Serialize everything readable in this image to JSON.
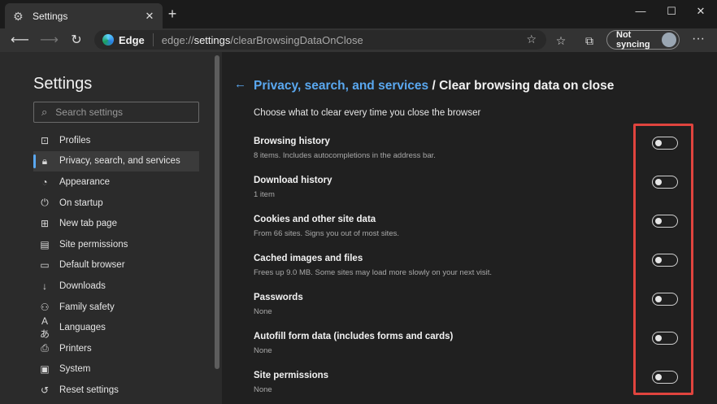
{
  "browser": {
    "tab_title": "Settings",
    "tab_close": "✕",
    "new_tab": "+",
    "window_controls": {
      "minimize": "—",
      "maximize": "☐",
      "close": "✕"
    },
    "edge_label": "Edge",
    "url_scheme": "edge://",
    "url_host": "settings",
    "url_path": "/clearBrowsingDataOnClose",
    "sync_label": "Not syncing",
    "more_label": "···"
  },
  "sidebar": {
    "title": "Settings",
    "search_placeholder": "Search settings",
    "items": [
      {
        "label": "Profiles",
        "icon": "profile-icon",
        "glyph": "⊡"
      },
      {
        "label": "Privacy, search, and services",
        "icon": "lock-icon",
        "glyph": "🔒︎"
      },
      {
        "label": "Appearance",
        "icon": "palette-icon",
        "glyph": "◔"
      },
      {
        "label": "On startup",
        "icon": "power-icon",
        "glyph": "⏻"
      },
      {
        "label": "New tab page",
        "icon": "new-tab-icon",
        "glyph": "⊞"
      },
      {
        "label": "Site permissions",
        "icon": "site-permissions-icon",
        "glyph": "▤"
      },
      {
        "label": "Default browser",
        "icon": "default-browser-icon",
        "glyph": "▭"
      },
      {
        "label": "Downloads",
        "icon": "download-icon",
        "glyph": "↓"
      },
      {
        "label": "Family safety",
        "icon": "family-icon",
        "glyph": "⚇"
      },
      {
        "label": "Languages",
        "icon": "languages-icon",
        "glyph": "Aあ"
      },
      {
        "label": "Printers",
        "icon": "printer-icon",
        "glyph": "⎙"
      },
      {
        "label": "System",
        "icon": "system-icon",
        "glyph": "▣"
      },
      {
        "label": "Reset settings",
        "icon": "reset-icon",
        "glyph": "↺"
      }
    ],
    "active_index": 1
  },
  "main": {
    "breadcrumb_link": "Privacy, search, and services",
    "breadcrumb_sep": " / ",
    "breadcrumb_current": "Clear browsing data on close",
    "subtitle": "Choose what to clear every time you close the browser",
    "settings": [
      {
        "title": "Browsing history",
        "desc": "8 items. Includes autocompletions in the address bar.",
        "enabled": false
      },
      {
        "title": "Download history",
        "desc": "1 item",
        "enabled": false
      },
      {
        "title": "Cookies and other site data",
        "desc": "From 66 sites. Signs you out of most sites.",
        "enabled": false
      },
      {
        "title": "Cached images and files",
        "desc": "Frees up 9.0 MB. Some sites may load more slowly on your next visit.",
        "enabled": false
      },
      {
        "title": "Passwords",
        "desc": "None",
        "enabled": false
      },
      {
        "title": "Autofill form data (includes forms and cards)",
        "desc": "None",
        "enabled": false
      },
      {
        "title": "Site permissions",
        "desc": "None",
        "enabled": false
      }
    ]
  },
  "colors": {
    "accent": "#5aa8f0",
    "highlight": "#e0443e",
    "background": "#202020",
    "sidebar": "#2b2b2b"
  }
}
